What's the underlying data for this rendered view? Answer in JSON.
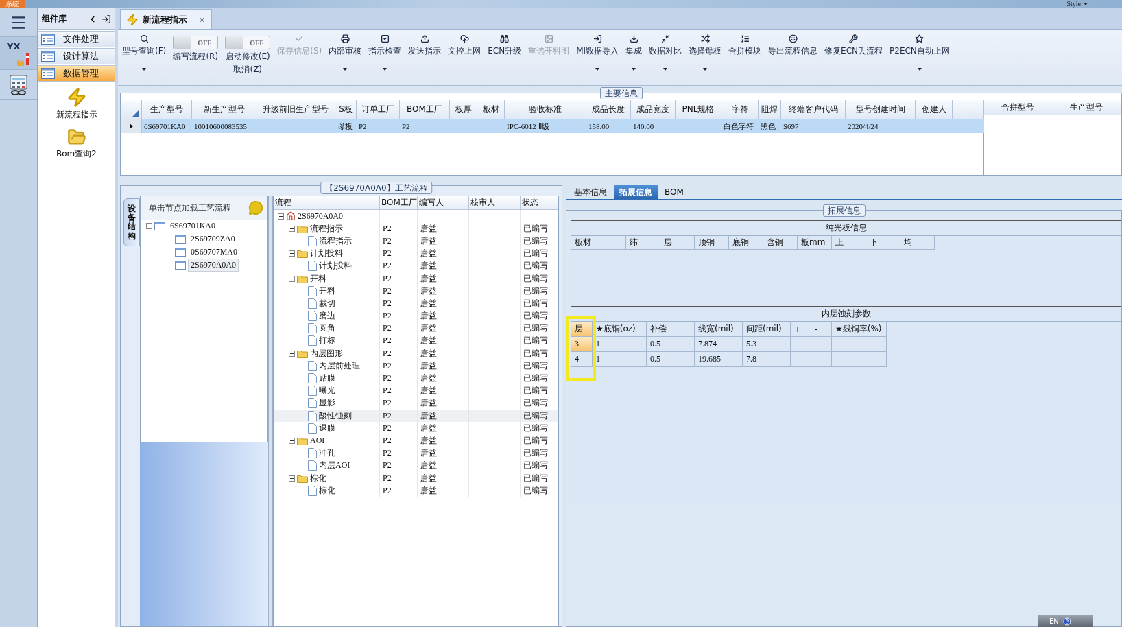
{
  "app": {
    "menu_label": "系统",
    "style_label": "Style",
    "logo_text": "YX"
  },
  "sidebar": {
    "title": "组件库",
    "groups": [
      {
        "label": "文件处理",
        "selected": false
      },
      {
        "label": "设计算法",
        "selected": false
      },
      {
        "label": "数据管理",
        "selected": true
      }
    ],
    "shortcuts": [
      {
        "label": "新流程指示",
        "kind": "bolt"
      },
      {
        "label": "Bom查询2",
        "kind": "folder"
      }
    ]
  },
  "document_tab": {
    "title": "新流程指示",
    "close_glyph": "×"
  },
  "toolbar": [
    {
      "kind": "button",
      "label": "型号查询(F)",
      "dropdown": true,
      "disabled": false
    },
    {
      "kind": "toggle",
      "label": "编写流程(R)",
      "switch_text": "OFF",
      "on": false
    },
    {
      "kind": "toggle",
      "label": "启动修改(E)",
      "sublabel": "取消(Z)",
      "switch_text": "OFF",
      "on": false
    },
    {
      "kind": "button",
      "label": "保存信息(S)",
      "dropdown": false,
      "disabled": true
    },
    {
      "kind": "button",
      "label": "内部审核",
      "dropdown": true,
      "disabled": false
    },
    {
      "kind": "button",
      "label": "指示检查",
      "dropdown": true,
      "disabled": false
    },
    {
      "kind": "button",
      "label": "发送指示",
      "dropdown": false,
      "disabled": false
    },
    {
      "kind": "button",
      "label": "文控上网",
      "dropdown": false,
      "disabled": false
    },
    {
      "kind": "button",
      "label": "ECN升级",
      "dropdown": false,
      "disabled": false
    },
    {
      "kind": "button",
      "label": "重选开料图",
      "dropdown": false,
      "disabled": true
    },
    {
      "kind": "button",
      "label": "MI数据导入",
      "dropdown": true,
      "disabled": false
    },
    {
      "kind": "button",
      "label": "集成",
      "dropdown": true,
      "disabled": false
    },
    {
      "kind": "button",
      "label": "数据对比",
      "dropdown": true,
      "disabled": false
    },
    {
      "kind": "button",
      "label": "选择母板",
      "dropdown": true,
      "disabled": false
    },
    {
      "kind": "button",
      "label": "合拼模块",
      "dropdown": false,
      "disabled": false
    },
    {
      "kind": "button",
      "label": "导出流程信息",
      "dropdown": false,
      "disabled": false
    },
    {
      "kind": "button",
      "label": "修复ECN丢流程",
      "dropdown": false,
      "disabled": false
    },
    {
      "kind": "button",
      "label": "P2ECN自动上网",
      "dropdown": true,
      "disabled": false
    }
  ],
  "main_info": {
    "title": "主要信息",
    "columns": [
      "生产型号",
      "新生产型号",
      "升级前旧生产型号",
      "S板",
      "订单工厂",
      "BOM工厂",
      "板厚",
      "板材",
      "验收标准",
      "成品长度",
      "成品宽度",
      "PNL规格",
      "字符",
      "阻焊",
      "终端客户代码",
      "型号创建时间",
      "创建人"
    ],
    "rows": [
      {
        "selected": true,
        "cells": [
          "6S69701KA0",
          "10010600083535",
          null,
          "母板",
          "P2",
          "P2",
          null,
          null,
          "IPC-6012 Ⅱ级",
          "158.00",
          "140.00",
          null,
          "白色字符",
          "黑色",
          "S697",
          "2020/4/24",
          null
        ]
      }
    ],
    "side_columns": [
      "合拼型号",
      "生产型号"
    ]
  },
  "process": {
    "title": "【2S6970A0A0】工艺流程",
    "side_tab": "设备结构",
    "hint": "单击节点加载工艺流程",
    "structure": [
      {
        "label": "6S69701KA0",
        "expanded": true,
        "selected": false,
        "children": [
          {
            "label": "2S69709ZA0",
            "selected": false
          },
          {
            "label": "0S69707MA0",
            "selected": false
          },
          {
            "label": "2S6970A0A0",
            "selected": true
          }
        ]
      }
    ],
    "columns": [
      "流程",
      "BOM工厂",
      "编写人",
      "核审人",
      "状态"
    ],
    "tree": [
      {
        "label": "2S6970A0A0",
        "kind": "root",
        "expanded": true,
        "selected": false,
        "children": [
          {
            "label": "流程指示",
            "kind": "folder",
            "expanded": true,
            "selected": false,
            "factory": "P2",
            "author": "唐益",
            "status": "已编写",
            "children": [
              {
                "label": "流程指示",
                "kind": "step",
                "selected": false,
                "factory": "P2",
                "author": "唐益",
                "status": "已编写"
              }
            ]
          },
          {
            "label": "计划投料",
            "kind": "folder",
            "expanded": true,
            "selected": false,
            "factory": "P2",
            "author": "唐益",
            "status": "已编写",
            "children": [
              {
                "label": "计划投料",
                "kind": "step",
                "selected": false,
                "factory": "P2",
                "author": "唐益",
                "status": "已编写"
              }
            ]
          },
          {
            "label": "开料",
            "kind": "folder",
            "expanded": true,
            "selected": false,
            "factory": "P2",
            "author": "唐益",
            "status": "已编写",
            "children": [
              {
                "label": "开料",
                "kind": "step",
                "selected": false,
                "factory": "P2",
                "author": "唐益",
                "status": "已编写"
              },
              {
                "label": "裁切",
                "kind": "step",
                "selected": false,
                "factory": "P2",
                "author": "唐益",
                "status": "已编写"
              },
              {
                "label": "磨边",
                "kind": "step",
                "selected": false,
                "factory": "P2",
                "author": "唐益",
                "status": "已编写"
              },
              {
                "label": "圆角",
                "kind": "step",
                "selected": false,
                "factory": "P2",
                "author": "唐益",
                "status": "已编写"
              },
              {
                "label": "打标",
                "kind": "step",
                "selected": false,
                "factory": "P2",
                "author": "唐益",
                "status": "已编写"
              }
            ]
          },
          {
            "label": "内层图形",
            "kind": "folder",
            "expanded": true,
            "selected": false,
            "factory": "P2",
            "author": "唐益",
            "status": "已编写",
            "children": [
              {
                "label": "内层前处理",
                "kind": "step",
                "selected": false,
                "factory": "P2",
                "author": "唐益",
                "status": "已编写"
              },
              {
                "label": "贴膜",
                "kind": "step",
                "selected": false,
                "factory": "P2",
                "author": "唐益",
                "status": "已编写"
              },
              {
                "label": "曝光",
                "kind": "step",
                "selected": false,
                "factory": "P2",
                "author": "唐益",
                "status": "已编写"
              },
              {
                "label": "显影",
                "kind": "step",
                "selected": false,
                "factory": "P2",
                "author": "唐益",
                "status": "已编写"
              },
              {
                "label": "酸性蚀刻",
                "kind": "step",
                "selected": true,
                "factory": "P2",
                "author": "唐益",
                "status": "已编写"
              },
              {
                "label": "退膜",
                "kind": "step",
                "selected": false,
                "factory": "P2",
                "author": "唐益",
                "status": "已编写"
              }
            ]
          },
          {
            "label": "AOI",
            "kind": "folder",
            "expanded": true,
            "selected": false,
            "factory": "P2",
            "author": "唐益",
            "status": "已编写",
            "children": [
              {
                "label": "冲孔",
                "kind": "step",
                "selected": false,
                "factory": "P2",
                "author": "唐益",
                "status": "已编写"
              },
              {
                "label": "内层AOI",
                "kind": "step",
                "selected": false,
                "factory": "P2",
                "author": "唐益",
                "status": "已编写"
              }
            ]
          },
          {
            "label": "棕化",
            "kind": "folder",
            "expanded": true,
            "selected": false,
            "factory": "P2",
            "author": "唐益",
            "status": "已编写",
            "children": [
              {
                "label": "棕化",
                "kind": "step",
                "selected": false,
                "factory": "P2",
                "author": "唐益",
                "status": "已编写"
              }
            ]
          }
        ]
      }
    ]
  },
  "detail": {
    "tabs": [
      {
        "label": "基本信息",
        "selected": false
      },
      {
        "label": "拓展信息",
        "selected": true
      },
      {
        "label": "BOM",
        "selected": false
      }
    ],
    "group_title": "拓展信息",
    "bare_board": {
      "title": "纯光板信息",
      "columns": [
        "板材",
        "纬",
        "层",
        "顶铜",
        "底铜",
        "含铜",
        "板mm",
        "上",
        "下",
        "均"
      ]
    },
    "etching": {
      "title": "内层蚀刻参数",
      "highlighted": true,
      "columns": [
        "层",
        "★底铜(oz)",
        "补偿",
        "线宽(mil)",
        "间距(mil)",
        "+",
        "-",
        "★残铜率(%)"
      ],
      "rows": [
        [
          "3",
          "1",
          "0.5",
          "7.874",
          "5.3",
          null,
          null,
          null
        ],
        [
          "4",
          "1",
          "0.5",
          "19.685",
          "7.8",
          null,
          null,
          null
        ]
      ]
    }
  },
  "ime_bar": {
    "language": "EN"
  }
}
